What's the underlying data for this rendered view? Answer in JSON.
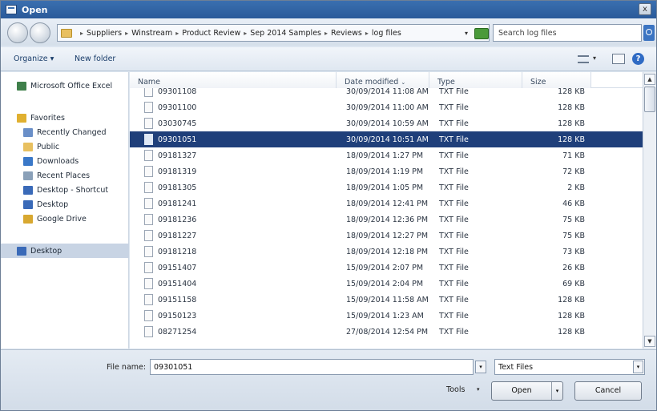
{
  "window": {
    "title": "Open",
    "close_glyph": "x"
  },
  "address": {
    "path": [
      "Suppliers",
      "Winstream",
      "Product Review",
      "Sep 2014 Samples",
      "Reviews",
      "log files"
    ],
    "separator": "▸",
    "dropdown_glyph": "▾",
    "search_placeholder": "Search log files"
  },
  "toolbar": {
    "organize_label": "Organize ▾",
    "new_folder_label": "New folder",
    "views_drop_glyph": "▾",
    "help_glyph": "?"
  },
  "navigation": {
    "items": [
      {
        "label": "Microsoft Office Excel",
        "icon": "excel-icon",
        "color": "#3f7f4a"
      },
      {
        "label": "Favorites",
        "icon": "star-icon",
        "color": "#e0b030"
      },
      {
        "label": "Recently Changed",
        "icon": "recent-icon",
        "color": "#6a8fc8"
      },
      {
        "label": "Public",
        "icon": "folder-icon",
        "color": "#e8c060"
      },
      {
        "label": "Downloads",
        "icon": "downloads-icon",
        "color": "#3a78c8"
      },
      {
        "label": "Recent Places",
        "icon": "recent-places-icon",
        "color": "#8aa0b8"
      },
      {
        "label": "Desktop - Shortcut",
        "icon": "desktop-icon",
        "color": "#3a6ab8"
      },
      {
        "label": "Desktop",
        "icon": "desktop-icon",
        "color": "#3a6ab8"
      },
      {
        "label": "Google Drive",
        "icon": "google-drive-icon",
        "color": "#d8a830"
      },
      {
        "label": "Desktop",
        "icon": "desktop-icon",
        "color": "#3a6ab8",
        "selected": true
      }
    ]
  },
  "filelist": {
    "columns": {
      "name": "Name",
      "date": "Date modified",
      "type": "Type",
      "size": "Size"
    },
    "rows": [
      {
        "name": "09301108",
        "date": "30/09/2014 11:08 AM",
        "type": "TXT File",
        "size": "128 KB"
      },
      {
        "name": "09301100",
        "date": "30/09/2014 11:00 AM",
        "type": "TXT File",
        "size": "128 KB"
      },
      {
        "name": "03030745",
        "date": "30/09/2014 10:59 AM",
        "type": "TXT File",
        "size": "128 KB"
      },
      {
        "name": "09301051",
        "date": "30/09/2014 10:51 AM",
        "type": "TXT File",
        "size": "128 KB",
        "selected": true
      },
      {
        "name": "09181327",
        "date": "18/09/2014 1:27 PM",
        "type": "TXT File",
        "size": "71 KB"
      },
      {
        "name": "09181319",
        "date": "18/09/2014 1:19 PM",
        "type": "TXT File",
        "size": "72 KB"
      },
      {
        "name": "09181305",
        "date": "18/09/2014 1:05 PM",
        "type": "TXT File",
        "size": "2 KB"
      },
      {
        "name": "09181241",
        "date": "18/09/2014 12:41 PM",
        "type": "TXT File",
        "size": "46 KB"
      },
      {
        "name": "09181236",
        "date": "18/09/2014 12:36 PM",
        "type": "TXT File",
        "size": "75 KB"
      },
      {
        "name": "09181227",
        "date": "18/09/2014 12:27 PM",
        "type": "TXT File",
        "size": "75 KB"
      },
      {
        "name": "09181218",
        "date": "18/09/2014 12:18 PM",
        "type": "TXT File",
        "size": "73 KB"
      },
      {
        "name": "09151407",
        "date": "15/09/2014 2:07 PM",
        "type": "TXT File",
        "size": "26 KB"
      },
      {
        "name": "09151404",
        "date": "15/09/2014 2:04 PM",
        "type": "TXT File",
        "size": "69 KB"
      },
      {
        "name": "09151158",
        "date": "15/09/2014 11:58 AM",
        "type": "TXT File",
        "size": "128 KB"
      },
      {
        "name": "09150123",
        "date": "15/09/2014 1:23 AM",
        "type": "TXT File",
        "size": "128 KB"
      },
      {
        "name": "08271254",
        "date": "27/08/2014 12:54 PM",
        "type": "TXT File",
        "size": "128 KB"
      }
    ]
  },
  "scrollbar": {
    "up_glyph": "▲",
    "down_glyph": "▼"
  },
  "bottom": {
    "file_name_label": "File name:",
    "file_name_value": "09301051",
    "file_type_value": "Text Files",
    "dropdown_glyph": "▾",
    "tools_label": "Tools",
    "open_label": "Open",
    "cancel_label": "Cancel"
  }
}
